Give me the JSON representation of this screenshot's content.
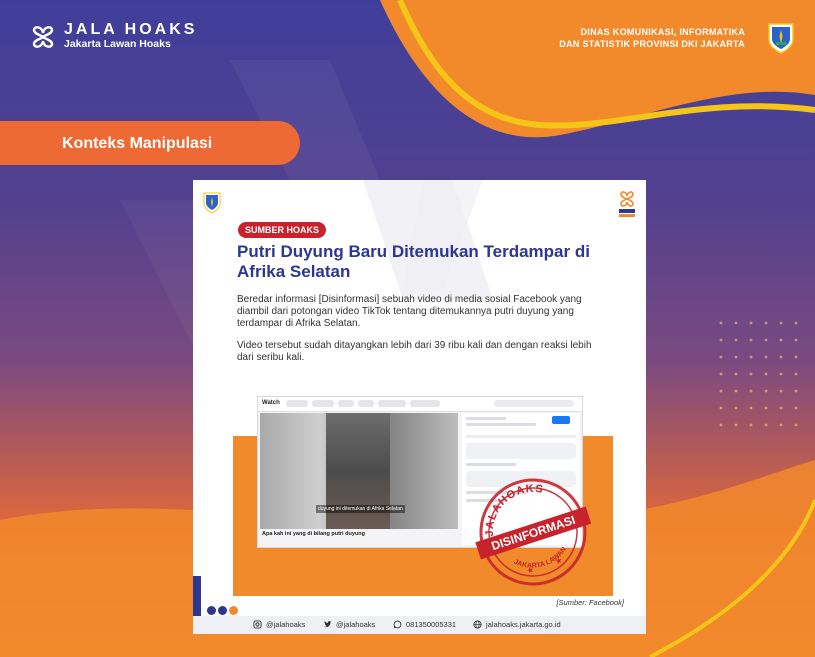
{
  "brand": {
    "name": "JALA HOAKS",
    "tagline": "Jakarta Lawan Hoaks"
  },
  "agency": {
    "line1": "DINAS KOMUNIKASI, INFORMATIKA",
    "line2": "DAN STATISTIK PROVINSI DKI JAKARTA"
  },
  "section_label": "Konteks Manipulasi",
  "card": {
    "badge": "SUMBER HOAKS",
    "headline": "Putri Duyung Baru Ditemukan Terdampar di Afrika Selatan",
    "paragraph1": "Beredar informasi [Disinformasi] sebuah video di media sosial Facebook yang diambil dari potongan video TikTok tentang ditemukannya putri duyung yang terdampar di Afrika Selatan.",
    "paragraph2": "Video tersebut sudah ditayangkan lebih dari 39 ribu kali dan dengan reaksi lebih dari seribu kali.",
    "screenshot": {
      "app_tab": "Watch",
      "video_caption": "duyung ini ditemukan di Afrika Selatan",
      "video_title": "Apa kah ini yang di bilang putri duyung"
    },
    "stamp": {
      "top_text": "JALAHOAKS",
      "main_text": "DISINFORMASI",
      "bottom_text": "JAKARTA LAWAN"
    },
    "source_note": "[Sumber: Facebook]",
    "footer": {
      "instagram": "@jalahoaks",
      "twitter": "@jalahoaks",
      "whatsapp": "081350005331",
      "website": "jalahoaks.jakarta.go.id"
    },
    "dot_colors": [
      "#2c3790",
      "#2c3790",
      "#f08a2a"
    ]
  },
  "colors": {
    "accent_orange": "#ee6a34",
    "navy": "#2c3790",
    "stamp_red": "#c8232c",
    "wave_yellow": "#f5c518"
  }
}
